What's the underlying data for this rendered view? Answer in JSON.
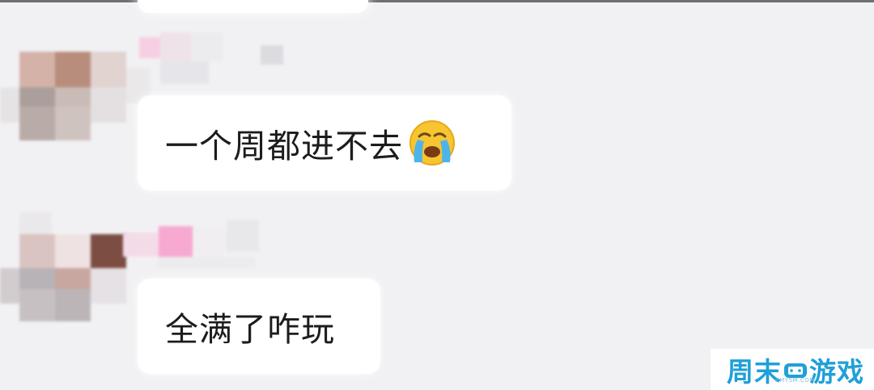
{
  "messages": [
    {
      "text": "一个周都进不去",
      "emoji": "loudly-crying-face",
      "sender_censored": true
    },
    {
      "text": "全满了咋玩",
      "sender_censored": true
    }
  ],
  "watermark": {
    "left": "周末",
    "right": "游戏",
    "icon": "gamepad-icon",
    "sub": "ZMYSM.COM",
    "color": "#1fa0d8"
  }
}
